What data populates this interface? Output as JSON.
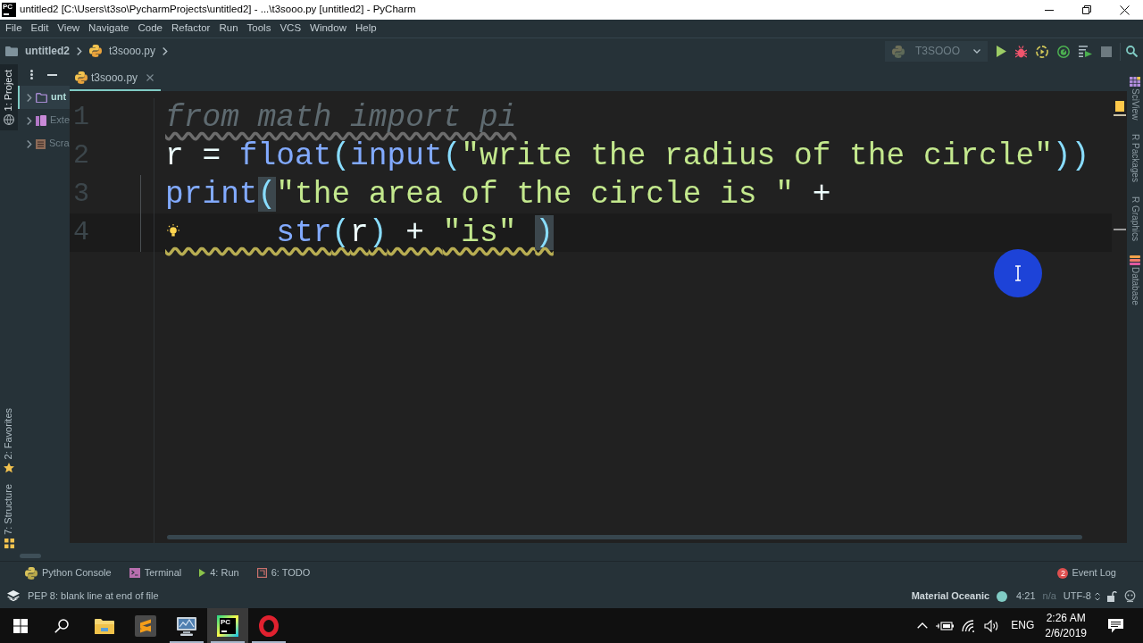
{
  "window": {
    "app_icon": "PC",
    "title": "untitled2 [C:\\Users\\t3so\\PycharmProjects\\untitled2] - ...\\t3sooo.py [untitled2] - PyCharm"
  },
  "menu": [
    "File",
    "Edit",
    "View",
    "Navigate",
    "Code",
    "Refactor",
    "Run",
    "Tools",
    "VCS",
    "Window",
    "Help"
  ],
  "breadcrumbs": [
    {
      "kind": "project",
      "label": "untitled2"
    },
    {
      "kind": "python_file",
      "label": "t3sooo.py"
    }
  ],
  "run_configuration": {
    "label": "T3SOOO"
  },
  "left_tool_windows": [
    {
      "kind": "project",
      "label": "1: Project",
      "selected": true
    },
    {
      "kind": "favorites",
      "label": "2: Favorites",
      "selected": false
    },
    {
      "kind": "structure",
      "label": "7: Structure",
      "selected": false
    }
  ],
  "project_tree": [
    {
      "kind": "project_folder",
      "label": "unt",
      "selected": true
    },
    {
      "kind": "libraries",
      "label": "Exte",
      "selected": false
    },
    {
      "kind": "scratches",
      "label": "Scra",
      "selected": false
    }
  ],
  "editor": {
    "tabs": [
      {
        "label": "t3sooo.py",
        "selected": true
      }
    ],
    "lines": [
      {
        "number": "1",
        "current": false,
        "fold_guide": false,
        "intention_bulb": false,
        "unused_underline": true,
        "warning_underline": false,
        "tokens": [
          {
            "kind": "unused",
            "text": "from math import pi"
          }
        ]
      },
      {
        "number": "2",
        "current": false,
        "fold_guide": false,
        "intention_bulb": false,
        "unused_underline": false,
        "warning_underline": false,
        "tokens": [
          {
            "kind": "plain",
            "text": "r = "
          },
          {
            "kind": "builtin",
            "text": "float"
          },
          {
            "kind": "punct",
            "text": "("
          },
          {
            "kind": "builtin",
            "text": "input"
          },
          {
            "kind": "punct",
            "text": "("
          },
          {
            "kind": "string",
            "text": "\"write the radius of the circle\""
          },
          {
            "kind": "punct",
            "text": "))"
          }
        ]
      },
      {
        "number": "3",
        "current": false,
        "fold_guide": true,
        "intention_bulb": false,
        "unused_underline": false,
        "warning_underline": false,
        "tokens": [
          {
            "kind": "builtin",
            "text": "print"
          },
          {
            "kind": "brace_match",
            "text": "("
          },
          {
            "kind": "string",
            "text": "\"the area of the circle is \""
          },
          {
            "kind": "plain",
            "text": " +"
          }
        ]
      },
      {
        "number": "4",
        "current": true,
        "fold_guide": true,
        "intention_bulb": true,
        "unused_underline": false,
        "warning_underline": true,
        "tokens": [
          {
            "kind": "builtin",
            "text": "      str"
          },
          {
            "kind": "punct",
            "text": "("
          },
          {
            "kind": "plain",
            "text": "r"
          },
          {
            "kind": "punct",
            "text": ")"
          },
          {
            "kind": "plain",
            "text": " + "
          },
          {
            "kind": "string",
            "text": "\"is\" "
          },
          {
            "kind": "brace_match",
            "text": ")"
          }
        ]
      }
    ]
  },
  "right_tool_windows": [
    {
      "kind": "sciview",
      "label": "SciView"
    },
    {
      "kind": "plain",
      "label": "R Packages"
    },
    {
      "kind": "plain",
      "label": "R Graphics"
    },
    {
      "kind": "database",
      "label": "Database"
    }
  ],
  "bottom_tool_windows": [
    {
      "kind": "python_console",
      "label": "Python Console"
    },
    {
      "kind": "terminal",
      "label": "Terminal"
    },
    {
      "kind": "run",
      "label": "4: Run"
    },
    {
      "kind": "todo",
      "label": "6: TODO"
    }
  ],
  "event_log": {
    "count": "2",
    "label": "Event Log"
  },
  "status_bar": {
    "message": "PEP 8: blank line at end of file",
    "theme": "Material Oceanic",
    "position": "4:21",
    "line_separator": "n/a",
    "encoding": "UTF-8"
  },
  "taskbar": {
    "apps": [
      {
        "kind": "file_explorer",
        "running": false,
        "selected": false
      },
      {
        "kind": "sublime",
        "running": false,
        "selected": false
      },
      {
        "kind": "monitor",
        "running": true,
        "selected": false
      },
      {
        "kind": "pycharm",
        "logo_text": "PC",
        "running": true,
        "selected": true
      },
      {
        "kind": "opera",
        "running": true,
        "selected": false
      }
    ],
    "language": "ENG",
    "time": "2:26 AM",
    "date": "2/6/2019"
  }
}
